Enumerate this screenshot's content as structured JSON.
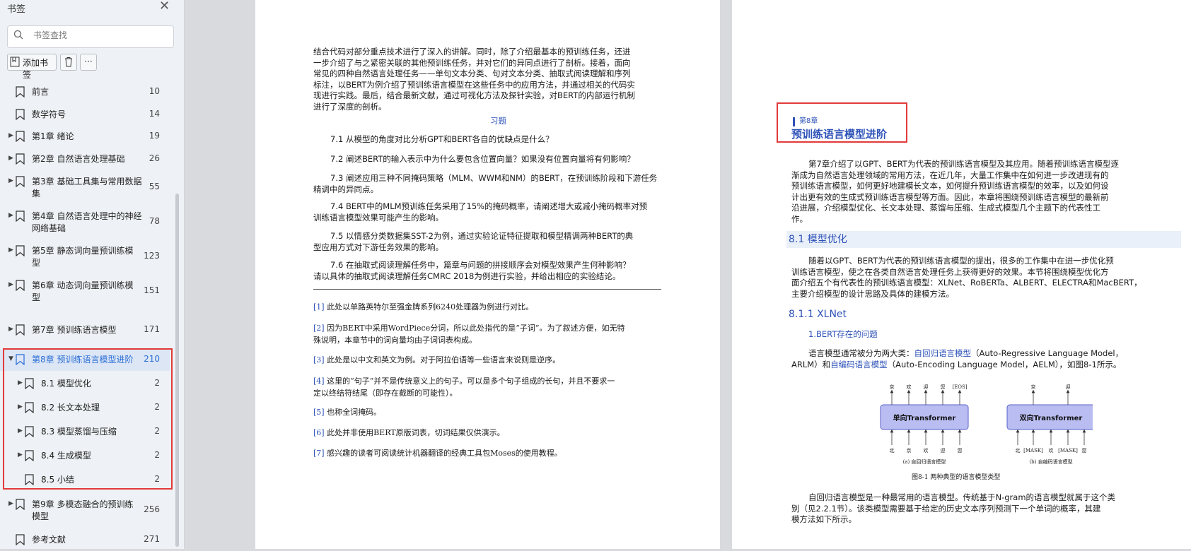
{
  "sidebar": {
    "title": "书签",
    "search_placeholder": "书签查找",
    "add_label": "添加书签",
    "more_label": "···",
    "items": [
      {
        "label": "前言",
        "page": "10"
      },
      {
        "label": "数学符号",
        "page": "14"
      },
      {
        "label": "第1章 绪论",
        "page": "19"
      },
      {
        "label": "第2章 自然语言处理基础",
        "page": "26"
      },
      {
        "label1": "第3章 基础工具集与常用数据",
        "label2": "集",
        "page": "55"
      },
      {
        "label1": "第4章 自然语言处理中的神经",
        "label2": "网络基础",
        "page": "78"
      },
      {
        "label1": "第5章 静态词向量预训练模",
        "label2": "型",
        "page": "123"
      },
      {
        "label1": "第6章 动态词向量预训练模",
        "label2": "型",
        "page": "151"
      },
      {
        "label": "第7章 预训练语言模型",
        "page": "171"
      },
      {
        "label": "第8章 预训练语言模型进阶",
        "page": "210"
      },
      {
        "label": "8.1 模型优化",
        "page": "2"
      },
      {
        "label": "8.2 长文本处理",
        "page": "2"
      },
      {
        "label": "8.3 模型蒸馏与压缩",
        "page": "2"
      },
      {
        "label": "8.4 生成模型",
        "page": "2"
      },
      {
        "label": "8.5 小结",
        "page": "2"
      },
      {
        "label1": "第9章 多模态融合的预训练",
        "label2": "模型",
        "page": "256"
      },
      {
        "label": "参考文献",
        "page": "271"
      }
    ]
  },
  "left_page": {
    "intro": [
      "结合代码对部分重点技术进行了深入的讲解。同时，除了介绍最基本的预训练任务，还进",
      "一步介绍了与之紧密关联的其他预训练任务，并对它们的异同点进行了剖析。接着，面向",
      "常见的四种自然语言处理任务——单句文本分类、句对文本分类、抽取式阅读理解和序列",
      "标注，以BERT为例介绍了预训练语言模型在这些任务中的应用方法，并通过相关的代码实",
      "现进行实践。最后，结合最新文献，通过可视化方法及探针实验，对BERT的内部运行机制",
      "进行了深度的剖析。"
    ],
    "exercise_title": "习题",
    "exercises": [
      [
        "7.1 从模型的角度对比分析GPT和BERT各自的优缺点是什么？"
      ],
      [
        "7.2 阐述BERT的输入表示中为什么要包含位置向量？如果没有位置向量将有何影响？"
      ],
      [
        "7.3 阐述应用三种不同掩码策略（MLM、WWM和NM）的BERT，在预训练阶段和下游任务",
        "精调中的异同点。"
      ],
      [
        "7.4 BERT中的MLM预训练任务采用了15%的掩码概率，请阐述增大或减小掩码概率对预",
        "训练语言模型效果可能产生的影响。"
      ],
      [
        "7.5 以情感分类数据集SST-2为例，通过实验论证特征提取和模型精调两种BERT的典",
        "型应用方式对下游任务效果的影响。"
      ],
      [
        "7.6 在抽取式阅读理解任务中，篇章与问题的拼接顺序会对模型效果产生何种影响？",
        "请以具体的抽取式阅读理解任务CMRC 2018为例进行实验，并给出相应的实验结论。"
      ]
    ],
    "footnotes": [
      {
        "num": "[1]",
        "lines": [
          "此处以单路英特尔至强金牌系列6240处理器为例进行对比。"
        ]
      },
      {
        "num": "[2]",
        "lines": [
          "因为BERT中采用WordPiece分词，所以此处指代的是“子词”。为了叙述方便，如无特",
          "殊说明，本章节中的词向量均由子词词表构成。"
        ]
      },
      {
        "num": "[3]",
        "lines": [
          "此处是以中文和英文为例。对于阿拉伯语等一些语言来说则是逆序。"
        ]
      },
      {
        "num": "[4]",
        "lines": [
          "这里的“句子”并不是传统意义上的句子。可以是多个句子组成的长句，并且不要求一",
          "定以终结符结尾（即存在截断的可能性）。"
        ]
      },
      {
        "num": "[5]",
        "lines": [
          "也称全词掩码。"
        ]
      },
      {
        "num": "[6]",
        "lines": [
          "此处并非使用BERT原版词表，切词结果仅供演示。"
        ]
      },
      {
        "num": "[7]",
        "lines": [
          "感兴趣的读者可阅读统计机器翻译的经典工具包Moses的使用教程。"
        ]
      }
    ]
  },
  "right_page": {
    "chapter_label": "第8章",
    "chapter_title": "预训练语言模型进阶",
    "intro": [
      "第7章介绍了以GPT、BERT为代表的预训练语言模型及其应用。随着预训练语言模型逐",
      "渐成为自然语言处理领域的常用方法，在近几年，大量工作集中在如何进一步改进现有的",
      "预训练语言模型，如何更好地建模长文本，如何提升预训练语言模型的效率，以及如何设",
      "计出更有效的生成式预训练语言模型等方面。因此，本章将围绕预训练语言模型的最新前",
      "沿进展，介绍模型优化、长文本处理、蒸馏与压缩、生成式模型几个主题下的代表性工",
      "作。"
    ],
    "sec81": "8.1 模型优化",
    "sec81_text": [
      "随着以GPT、BERT为代表的预训练语言模型的提出，很多的工作集中在进一步优化预",
      "训练语言模型，使之在各类自然语言处理任务上获得更好的效果。本节将围绕模型优化方",
      "面介绍五个有代表性的预训练语言模型：XLNet、RoBERTa、ALBERT、ELECTRA和MacBERT，",
      "主要介绍模型的设计思路及具体的建模方法。"
    ],
    "sec811": "8.1.1 XLNet",
    "sub1": "1.BERT存在的问题",
    "para_a": "语言模型通常被分为两大类：",
    "link1": "自回归语言模型",
    "para_b": "（Auto-Regressive Language Model，",
    "para_c": "ARLM）和",
    "link2": "自编码语言模型",
    "para_d": "（Auto-Encoding Language Model，AELM），如图8-1所示。",
    "fig": {
      "left_box": "单向Transformer",
      "right_box": "双向Transformer",
      "left_top": [
        "京",
        "欢",
        "迎",
        "您",
        "[EOS]"
      ],
      "left_bottom": [
        "北",
        "京",
        "欢",
        "迎",
        "您"
      ],
      "right_top": [
        "京",
        "迎"
      ],
      "right_bottom": [
        "北",
        "[MASK]",
        "欢",
        "[MASK]",
        "您"
      ],
      "caption_a": "(a) 自回归语言模型",
      "caption_b": "(b) 自编码语言模型",
      "caption": "图8-1 两种典型的语言模型类型"
    },
    "bottom_text": [
      "自回归语言模型是一种最常用的语言模型。传统基于N-gram的语言模型就属于这个类",
      "别（见2.2.1节）。该类模型需要基于给定的历史文本序列预测下一个单词的概率，其建",
      "模方法如下所示。"
    ]
  },
  "colors": {
    "accent": "#2d52b8",
    "highlight": "#e23a3a",
    "sidebar_active": "#2a6fd6"
  },
  "icons": [
    "close-icon",
    "search-icon",
    "bookmark-add-icon",
    "trash-icon",
    "bookmark-icon",
    "chevron-right-icon",
    "chevron-down-icon"
  ]
}
